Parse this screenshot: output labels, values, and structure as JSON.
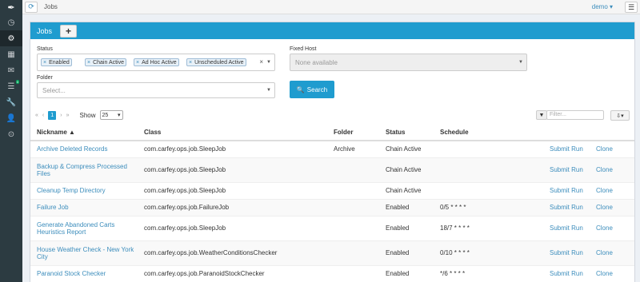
{
  "sidebar": {
    "logo_icon": "pen-icon",
    "items": [
      {
        "icon": "clock-icon",
        "glyph": "◷"
      },
      {
        "icon": "gear-icon",
        "glyph": "⚙"
      },
      {
        "icon": "table-icon",
        "glyph": "▦"
      },
      {
        "icon": "envelope-icon",
        "glyph": "✉"
      },
      {
        "icon": "list-icon",
        "glyph": "☰",
        "badge": "0"
      },
      {
        "icon": "wrench-icon",
        "glyph": "🔧"
      },
      {
        "icon": "user-icon",
        "glyph": "👤"
      },
      {
        "icon": "settings-icon",
        "glyph": "⊙"
      }
    ]
  },
  "topbar": {
    "breadcrumb": "Jobs",
    "user": "demo ▾"
  },
  "panel": {
    "title": "Jobs",
    "add_label": "+"
  },
  "filters": {
    "status_label": "Status",
    "status_tags": [
      "Enabled",
      "Chain Active",
      "Ad Hoc Active",
      "Unscheduled Active"
    ],
    "fixed_host_label": "Fixed Host",
    "fixed_host_placeholder": "None available",
    "folder_label": "Folder",
    "folder_placeholder": "Select...",
    "search_label": "Search"
  },
  "pager": {
    "first": "«",
    "prev": "‹",
    "current": "1",
    "next": "›",
    "last": "»",
    "show_label": "Show",
    "page_size": "25"
  },
  "filter_placeholder": "Filter...",
  "table": {
    "headers": {
      "nickname": "Nickname ▲",
      "class": "Class",
      "folder": "Folder",
      "status": "Status",
      "schedule": "Schedule"
    },
    "rows": [
      {
        "nickname": "Archive Deleted Records",
        "class": "com.carfey.ops.job.SleepJob",
        "folder": "Archive",
        "status": "Chain Active",
        "schedule": "",
        "submit": "Submit Run",
        "clone": "Clone"
      },
      {
        "nickname": "Backup & Compress Processed Files",
        "class": "com.carfey.ops.job.SleepJob",
        "folder": "",
        "status": "Chain Active",
        "schedule": "",
        "submit": "Submit Run",
        "clone": "Clone"
      },
      {
        "nickname": "Cleanup Temp Directory",
        "class": "com.carfey.ops.job.SleepJob",
        "folder": "",
        "status": "Chain Active",
        "schedule": "",
        "submit": "Submit Run",
        "clone": "Clone"
      },
      {
        "nickname": "Failure Job",
        "class": "com.carfey.ops.job.FailureJob",
        "folder": "",
        "status": "Enabled",
        "schedule": "0/5 * * * *",
        "submit": "Submit Run",
        "clone": "Clone"
      },
      {
        "nickname": "Generate Abandoned Carts Heuristics Report",
        "class": "com.carfey.ops.job.SleepJob",
        "folder": "",
        "status": "Enabled",
        "schedule": "18/7 * * * *",
        "submit": "Submit Run",
        "clone": "Clone"
      },
      {
        "nickname": "House Weather Check - New York City",
        "class": "com.carfey.ops.job.WeatherConditionsChecker",
        "folder": "",
        "status": "Enabled",
        "schedule": "0/10 * * * *",
        "submit": "Submit Run",
        "clone": "Clone"
      },
      {
        "nickname": "Paranoid Stock Checker",
        "class": "com.carfey.ops.job.ParanoidStockChecker",
        "folder": "",
        "status": "Enabled",
        "schedule": "*/6 * * * *",
        "submit": "Submit Run",
        "clone": "Clone"
      }
    ]
  }
}
